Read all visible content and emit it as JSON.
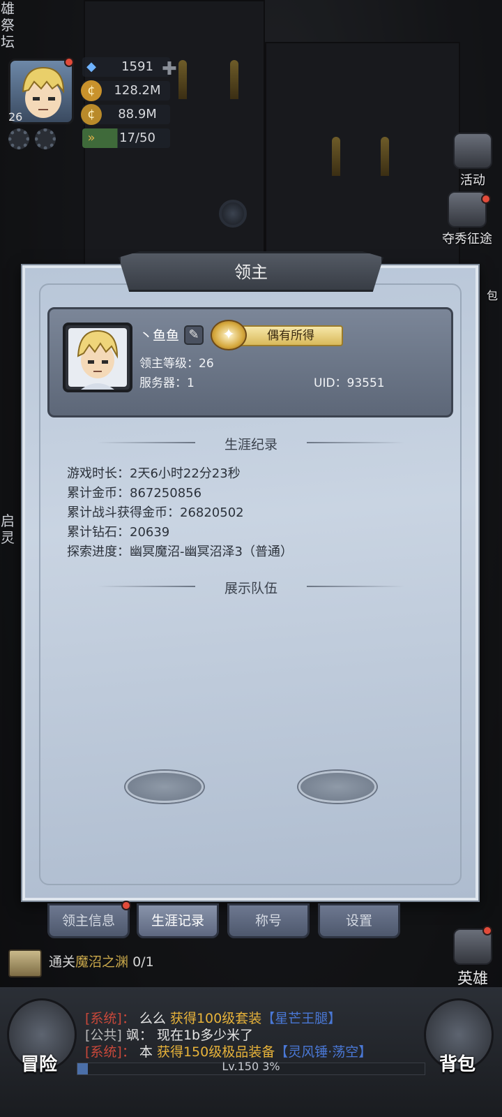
{
  "hud": {
    "side_top": "雄\n祭\n坛",
    "side_mid": "启\n灵",
    "level": "26",
    "diamonds": "1591",
    "gold": "128.2M",
    "coins": "88.9M",
    "stamina": "17/50"
  },
  "right_menu": {
    "activity": "活动",
    "campaign": "夺秀征途",
    "hero": "英雄",
    "bag_partial": "包"
  },
  "dialog": {
    "title": "领主",
    "player_name": "丶鱼鱼",
    "title_badge": "偶有所得",
    "level_line": "领主等级：26",
    "server_line": "服务器：1",
    "uid_line": "UID：93551",
    "career_header": "生涯纪录",
    "stats": [
      "游戏时长：2天6小时22分23秒",
      "累计金币：867250856",
      "累计战斗获得金币：26820502",
      "累计钻石：20639",
      "探索进度：幽冥魔沼-幽冥沼泽3（普通）"
    ],
    "team_header": "展示队伍"
  },
  "tabs": [
    "领主信息",
    "生涯记录",
    "称号",
    "设置"
  ],
  "quest": {
    "prefix": "通关",
    "target": "魔沼之渊",
    "progress": "0/1"
  },
  "chat": [
    {
      "tag": "[系统]：",
      "name": "么么",
      "text": "获得100级套装",
      "item": "【星芒王腿】"
    },
    {
      "tag": "[公共]",
      "name": "飒：",
      "text": "现在1b多少米了"
    },
    {
      "tag": "[系统]：",
      "name": "本",
      "text": "获得150级极品装备",
      "item": "【灵风锤·荡空】"
    }
  ],
  "bottom": {
    "adventure": "冒险",
    "bag": "背包",
    "xp_level": "Lv.150",
    "xp_percent": "3%",
    "xp_fraction": 0.03
  },
  "colors": {
    "system_tag": "#c9483a",
    "public_tag": "#b8b8b8",
    "item_blue": "#4a78d6",
    "quest_target": "#c9a84b",
    "gold_text": "#e8b33a"
  }
}
